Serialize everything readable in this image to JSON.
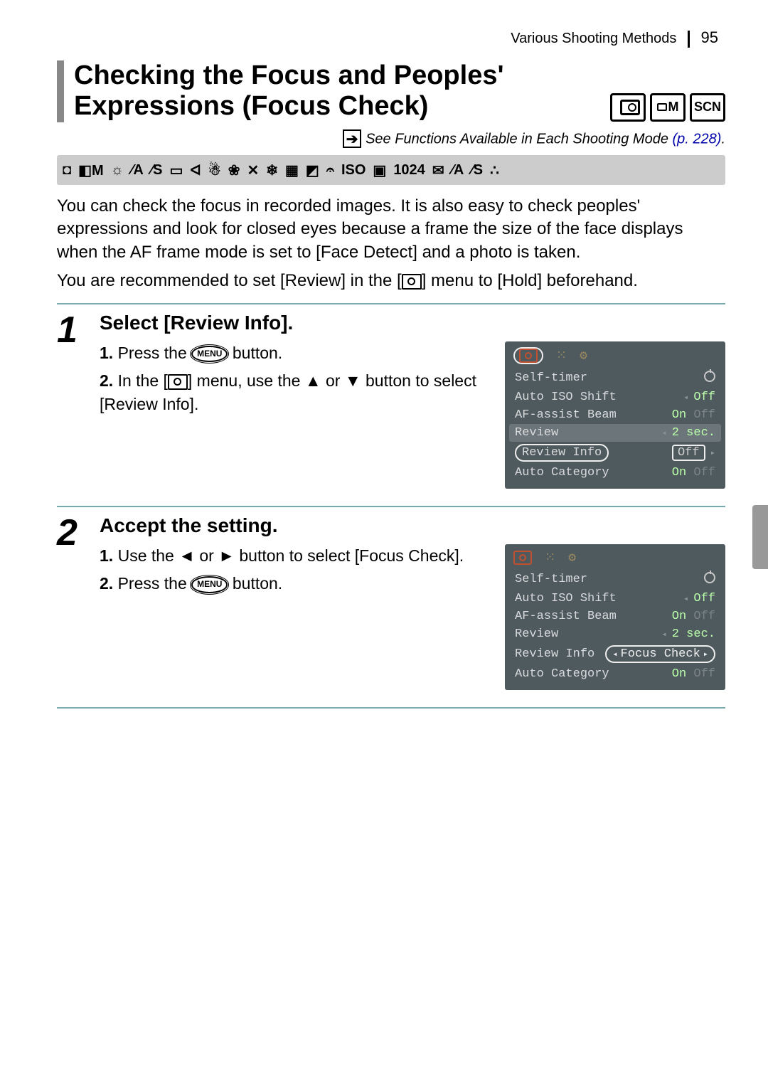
{
  "header": {
    "section": "Various Shooting Methods",
    "page": "95"
  },
  "title": "Checking the Focus and Peoples' Expressions (Focus Check)",
  "mode_badges": [
    "",
    "M",
    "SCN"
  ],
  "see_line": {
    "prefix": "See ",
    "text": "Functions Available in Each Shooting Mode",
    "link": "(p. 228)"
  },
  "iconstrip": [
    "◘",
    "◧M",
    "☼",
    "⁄A",
    "⁄S",
    "▭",
    "ᐊ",
    "☃",
    "❀",
    "✕",
    "❄",
    "▦",
    "◩",
    "𝄐",
    "ISO",
    "▣",
    "1024",
    "✉",
    "⁄A",
    "⁄S",
    "∴"
  ],
  "para1": "You can check the focus in recorded images. It is also easy to check peoples' expressions and look for closed eyes because a frame the size of the face displays when the AF frame mode is set to [Face Detect] and a photo is taken.",
  "para2a": "You are recommended to set [Review] in the [",
  "para2b": "] menu to [Hold] beforehand.",
  "steps": [
    {
      "num": "1",
      "head": "Select [Review Info].",
      "lines": [
        {
          "n": "1.",
          "pre": "Press the ",
          "btn": "MENU",
          "post": " button."
        },
        {
          "n": "2.",
          "pre": "In the [",
          "cam": true,
          "mid": "] menu, use the ",
          "a1": "▲",
          "or": " or ",
          "a2": "▼",
          "post": " button to select [Review Info]."
        }
      ],
      "lcd": {
        "circleTabs": true,
        "rows": [
          {
            "label": "Self-timer",
            "icon": "timer"
          },
          {
            "label": "Auto ISO Shift",
            "val": "Off",
            "tri": true
          },
          {
            "label": "AF-assist Beam",
            "val": "On",
            "valoff": "Off"
          },
          {
            "label": "Review",
            "val": "2 sec.",
            "hl": true,
            "tri": true
          },
          {
            "label": "Review Info",
            "circle": true,
            "boxval": "Off",
            "triR": true
          },
          {
            "label": "Auto Category",
            "val": "On",
            "valoff": "Off"
          }
        ]
      }
    },
    {
      "num": "2",
      "head": "Accept the setting.",
      "lines": [
        {
          "n": "1.",
          "pre": "Use the ",
          "a1": "◄",
          "or": " or ",
          "a2": "►",
          "post": " button to select [Focus Check]."
        },
        {
          "n": "2.",
          "pre": "Press the ",
          "btn": "MENU",
          "post": " button."
        }
      ],
      "lcd": {
        "circleTabs": false,
        "rows": [
          {
            "label": "Self-timer",
            "icon": "timer"
          },
          {
            "label": "Auto ISO Shift",
            "val": "Off",
            "tri": true
          },
          {
            "label": "AF-assist Beam",
            "val": "On",
            "valoff": "Off"
          },
          {
            "label": "Review",
            "val": "2 sec.",
            "tri": true
          },
          {
            "label": "Review Info",
            "pill": "Focus Check"
          },
          {
            "label": "Auto Category",
            "val": "On",
            "valoff": "Off"
          }
        ]
      }
    }
  ]
}
